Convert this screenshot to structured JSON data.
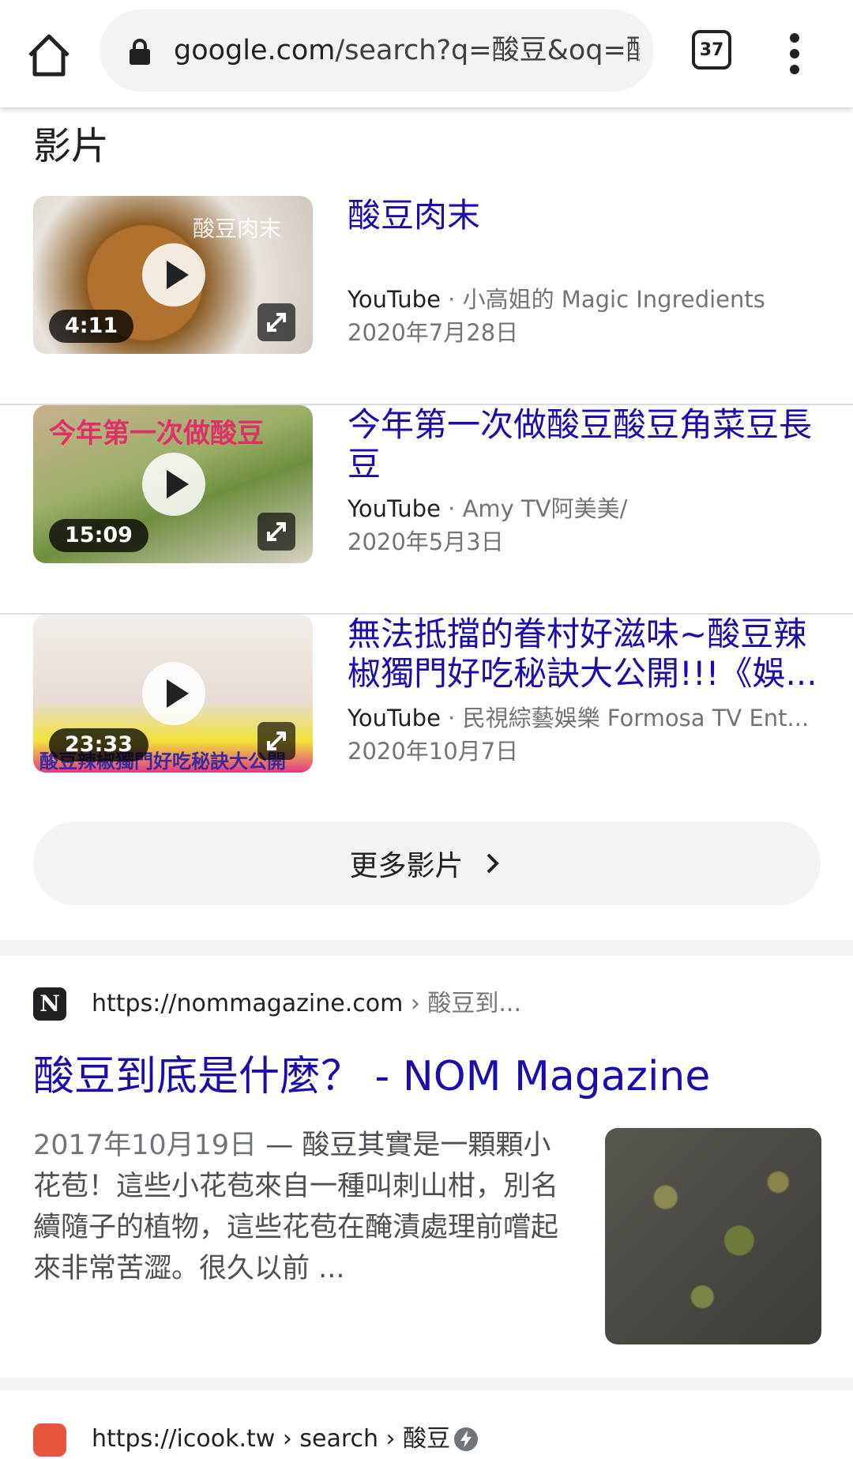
{
  "toolbar": {
    "url_host": "google.com",
    "url_path": "/search?q=酸豆&oq=酸豆",
    "tab_count": "37"
  },
  "videos": {
    "section_title": "影片",
    "items": [
      {
        "title": "酸豆肉末",
        "source": "YouTube",
        "channel": "小高姐的 Magic Ingredients",
        "date": "2020年7月28日",
        "duration": "4:11",
        "thumb_text": "酸豆肉末"
      },
      {
        "title": "今年第一次做酸豆酸豆角菜豆長豆",
        "source": "YouTube",
        "channel": "Amy TV阿美美/",
        "date": "2020年5月3日",
        "duration": "15:09",
        "thumb_text": "今年第一次做酸豆"
      },
      {
        "title": "無法抵擋的眷村好滋味~酸豆辣椒獨門好吃秘訣大公開!!!《娛...",
        "source": "YouTube",
        "channel": "民視綜藝娛樂 Formosa TV Ent...",
        "date": "2020年10月7日",
        "duration": "23:33",
        "thumb_text": "酸豆辣椒獨門好吃秘訣大公開"
      }
    ],
    "more_label": "更多影片"
  },
  "results": [
    {
      "favicon_letter": "N",
      "url": "https://nommagazine.com",
      "breadcrumb": " › 酸豆到...",
      "title": "酸豆到底是什麼？ - NOM Magazine",
      "date": "2017年10月19日",
      "snippet": " — 酸豆其實是一顆顆小花苞！這些小花苞來自一種叫刺山柑，別名續隨子的植物，這些花苞在醃漬處理前嚐起來非常苦澀。很久以前 ..."
    },
    {
      "url": "https://icook.tw",
      "breadcrumb": " › search › 酸豆"
    }
  ],
  "colors": {
    "link": "#1a0dab",
    "muted": "#70757a",
    "pill_bg": "#f1f3f4"
  }
}
